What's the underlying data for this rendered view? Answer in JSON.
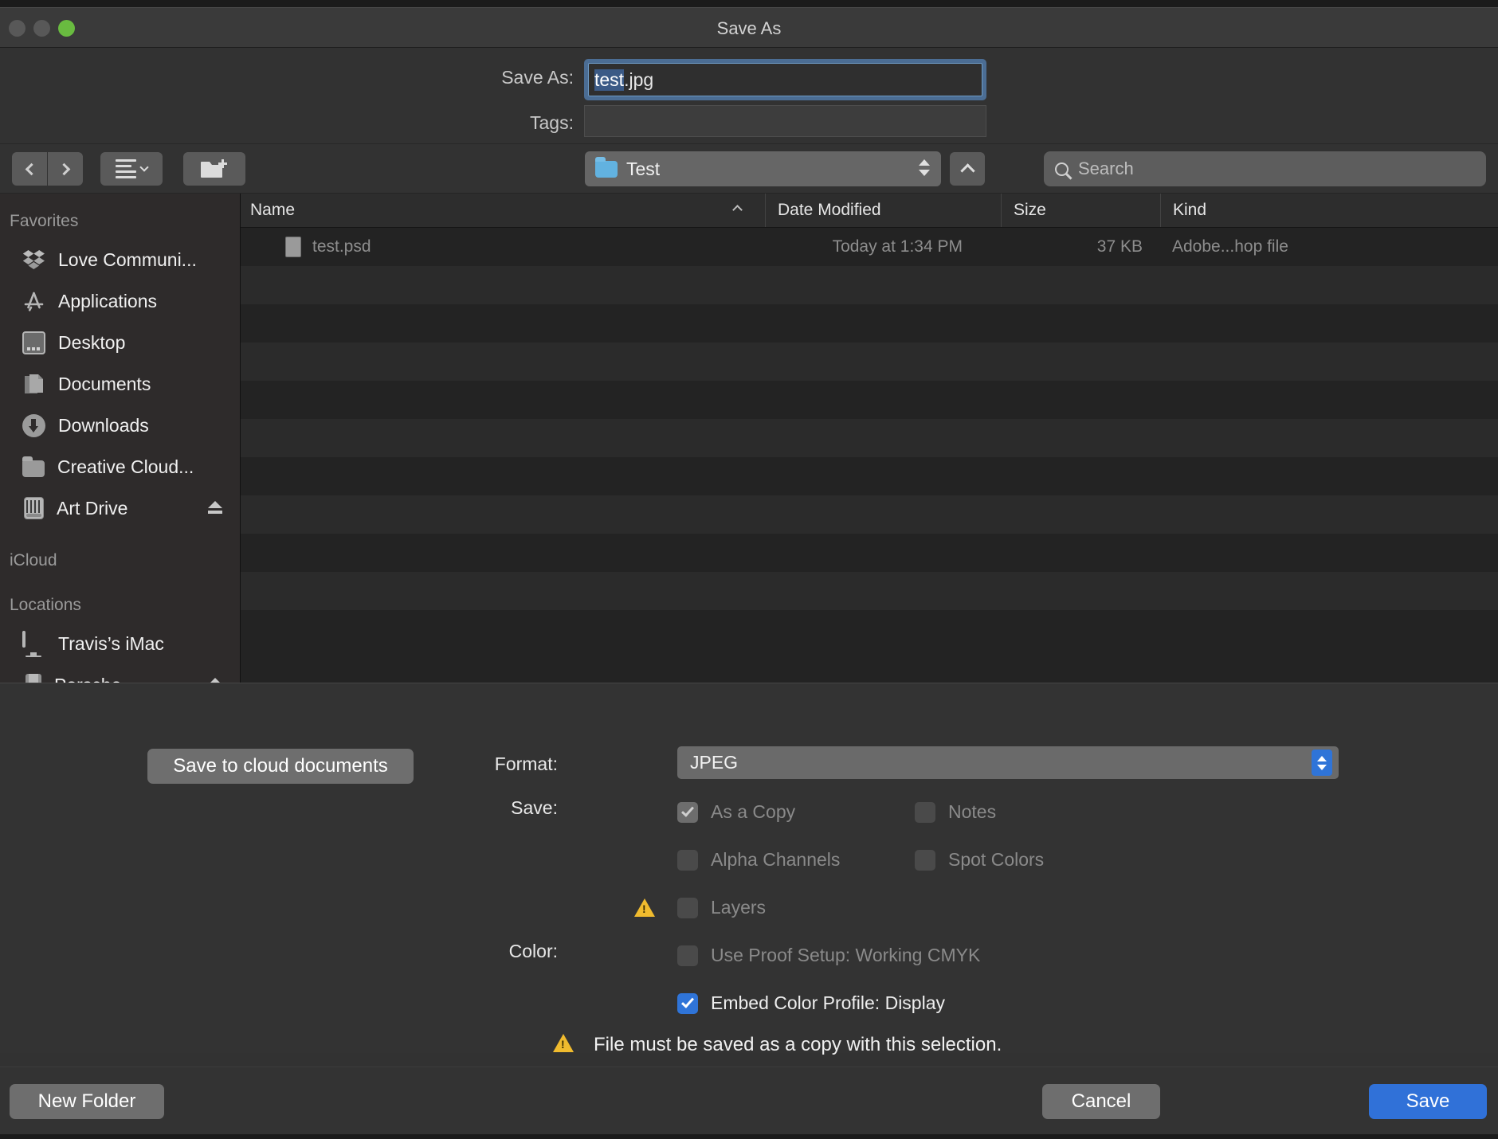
{
  "window": {
    "title": "Save As",
    "traffic_lights": [
      "close-disabled",
      "minimize-disabled",
      "zoom-green"
    ]
  },
  "name_panel": {
    "save_as_label": "Save As:",
    "file_name_selected": "test",
    "file_name_rest": ".jpg",
    "file_name_full": "test.jpg",
    "tags_label": "Tags:",
    "tags_value": ""
  },
  "toolbar": {
    "back_icon": "chevron-left-icon",
    "forward_icon": "chevron-right-icon",
    "view_icon": "list-view-icon",
    "new_folder_icon": "new-folder-icon",
    "path_label": "Test",
    "path_icon": "blue-folder-icon",
    "up_icon": "chevron-up-icon",
    "search_placeholder": "Search",
    "search_value": ""
  },
  "sidebar": {
    "sections": [
      {
        "header": "Favorites",
        "items": [
          {
            "label": "Love Communi...",
            "icon": "dropbox-icon",
            "eject": false
          },
          {
            "label": "Applications",
            "icon": "app-store-icon",
            "eject": false
          },
          {
            "label": "Desktop",
            "icon": "desktop-icon",
            "eject": false
          },
          {
            "label": "Documents",
            "icon": "documents-icon",
            "eject": false
          },
          {
            "label": "Downloads",
            "icon": "downloads-icon",
            "eject": false
          },
          {
            "label": "Creative Cloud...",
            "icon": "folder-icon",
            "eject": false
          },
          {
            "label": "Art Drive",
            "icon": "hard-drive-icon",
            "eject": true
          }
        ]
      },
      {
        "header": "iCloud",
        "items": []
      },
      {
        "header": "Locations",
        "items": [
          {
            "label": "Travis’s iMac",
            "icon": "imac-icon",
            "eject": false
          },
          {
            "label": "Porsche",
            "icon": "usb-drive-icon",
            "eject": true
          }
        ]
      }
    ]
  },
  "file_list": {
    "columns": [
      "Name",
      "Date Modified",
      "Size",
      "Kind"
    ],
    "sort_column": "Name",
    "sort_icon": "sort-ascending-caret",
    "rows": [
      {
        "name": "test.psd",
        "icon": "psd-file-icon",
        "date_modified": "Today at 1:34 PM",
        "size": "37 KB",
        "kind": "Adobe...hop file"
      }
    ],
    "empty_row_count": 9
  },
  "options": {
    "cloud_button": "Save to cloud documents",
    "format_label": "Format:",
    "format_value": "JPEG",
    "save_label": "Save:",
    "color_label": "Color:",
    "checkboxes": [
      {
        "label": "As a Copy",
        "checked": true,
        "enabled": false,
        "warning": false
      },
      {
        "label": "Notes",
        "checked": false,
        "enabled": false,
        "warning": false
      },
      {
        "label": "Alpha Channels",
        "checked": false,
        "enabled": false,
        "warning": false
      },
      {
        "label": "Spot Colors",
        "checked": false,
        "enabled": false,
        "warning": false
      },
      {
        "label": "Layers",
        "checked": false,
        "enabled": false,
        "warning": true
      },
      {
        "label": "Use Proof Setup:  Working CMYK",
        "checked": false,
        "enabled": false,
        "warning": false
      },
      {
        "label": "Embed Color Profile:  Display",
        "checked": true,
        "enabled": true,
        "warning": false
      }
    ],
    "warning_message": "File must be saved as a copy with this selection.",
    "warning_icon": "warning-triangle-icon"
  },
  "footer": {
    "new_folder": "New Folder",
    "cancel": "Cancel",
    "save": "Save"
  },
  "colors": {
    "accent_blue": "#3071d8",
    "selection_blue": "#3b5a86",
    "warning_yellow": "#f0bb2e",
    "zoom_green": "#69bb40",
    "window_bg": "#323232",
    "list_bg": "#232323"
  }
}
